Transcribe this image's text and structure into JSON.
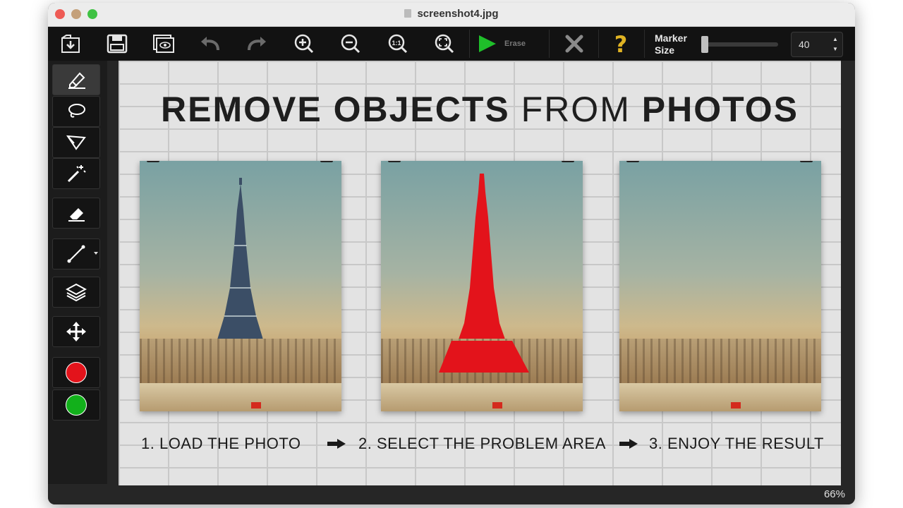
{
  "window": {
    "title": "screenshot4.jpg"
  },
  "toolbar": {
    "buttons": [
      {
        "name": "open-icon"
      },
      {
        "name": "save-icon"
      },
      {
        "name": "preview-icon"
      },
      {
        "name": "undo-icon"
      },
      {
        "name": "redo-icon"
      },
      {
        "name": "zoom-in-icon"
      },
      {
        "name": "zoom-out-icon"
      },
      {
        "name": "actual-size-icon"
      },
      {
        "name": "fit-screen-icon"
      }
    ],
    "erase_label": "Erase",
    "marker_label_line1": "Marker",
    "marker_label_line2": "Size",
    "marker_size_value": "40",
    "marker_slider_level": 0.05
  },
  "tools": [
    {
      "name": "marker-tool",
      "icon": "marker-icon",
      "active": true
    },
    {
      "name": "lasso-tool",
      "icon": "lasso-icon"
    },
    {
      "name": "polygonal-lasso-tool",
      "icon": "polygon-lasso-icon"
    },
    {
      "name": "magic-wand-tool",
      "icon": "magic-wand-icon"
    },
    {
      "name": "eraser-tool",
      "icon": "eraser-icon"
    },
    {
      "name": "line-tool",
      "icon": "line-icon"
    },
    {
      "name": "layers-tool",
      "icon": "layers-icon"
    },
    {
      "name": "move-tool",
      "icon": "move-icon"
    },
    {
      "name": "red-color",
      "color": "#e3131b"
    },
    {
      "name": "green-color",
      "color": "#12b01b"
    }
  ],
  "canvas": {
    "headline_bold1": "REMOVE OBJECTS",
    "headline_thin": "FROM",
    "headline_bold2": "PHOTOS",
    "step1": "1. LOAD THE PHOTO",
    "step2": "2. SELECT THE PROBLEM AREA",
    "step3": "3. ENJOY THE RESULT"
  },
  "status": {
    "zoom": "66%"
  },
  "colors": {
    "accent_play": "#1fbf2a",
    "help": "#e0b323",
    "selection_red": "#e3131b"
  }
}
